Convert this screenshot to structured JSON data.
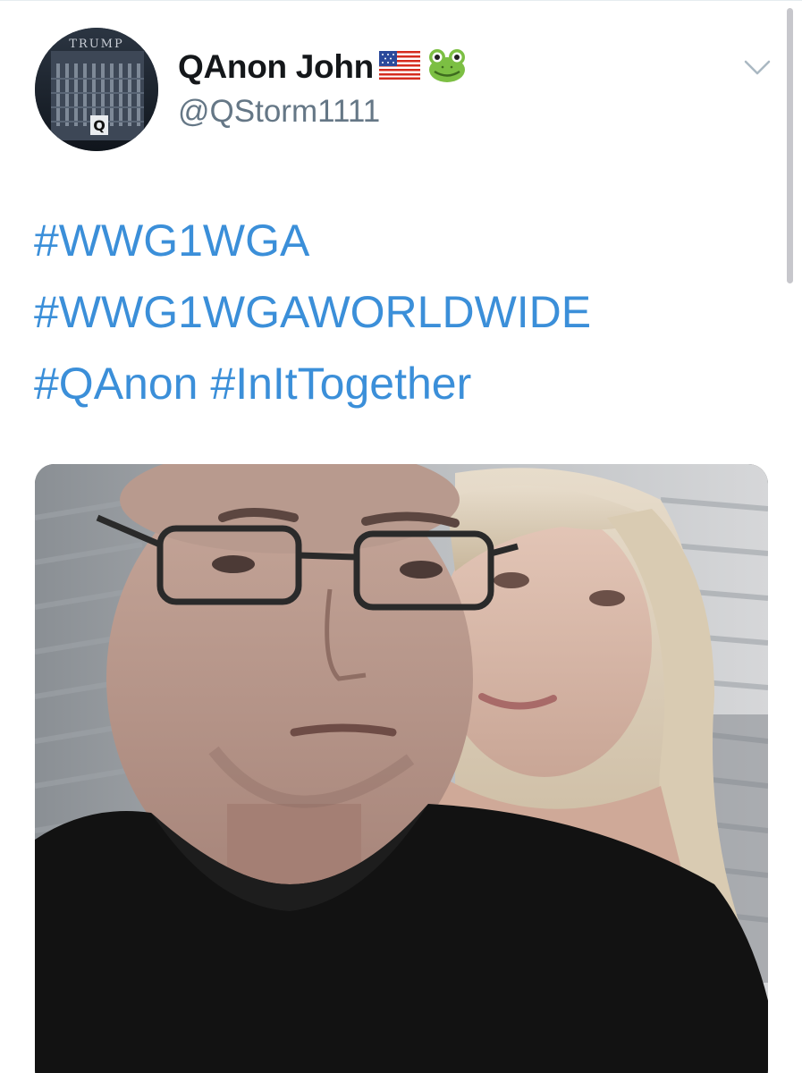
{
  "user": {
    "display_name": "QAnon John",
    "name_emojis": [
      "us-flag-icon",
      "frog-icon"
    ],
    "handle": "@QStorm1111",
    "avatar_text": "TRUMP",
    "avatar_badge": "Q"
  },
  "tweet": {
    "lines": [
      [
        "#WWG1WGA"
      ],
      [
        "#WWG1WGAWORLDWIDE"
      ],
      [
        "#QAnon",
        "#InItTogether"
      ]
    ]
  },
  "media": {
    "type": "video-still",
    "description_icon": "video-thumbnail"
  },
  "colors": {
    "hashtag": "#3b8fd9",
    "name": "#14171a",
    "handle": "#657786"
  }
}
